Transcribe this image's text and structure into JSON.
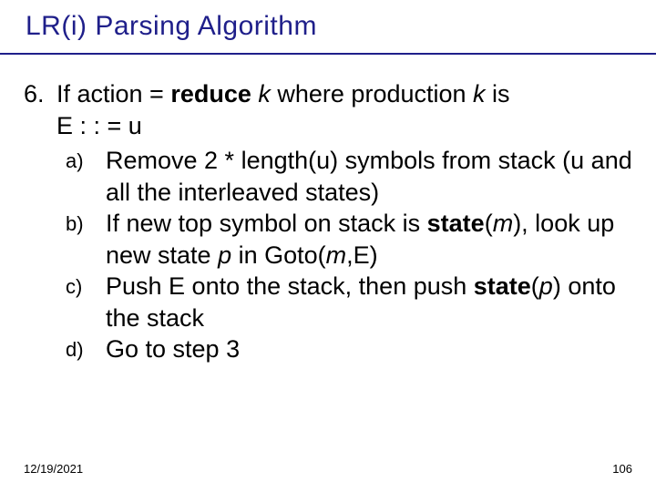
{
  "title": "LR(i) Parsing Algorithm",
  "item_number": "6.",
  "main_line_prefix": "If action = ",
  "main_line_reduce": "reduce",
  "main_line_mid1": " ",
  "main_line_k1": "k",
  "main_line_mid2": " where production ",
  "main_line_k2": "k",
  "main_line_suffix": " is",
  "main_line2": "E : : = u",
  "subs": [
    {
      "letter": "a)",
      "plain": "Remove 2 * length(u) symbols from stack (u and all the interleaved states)"
    },
    {
      "letter": "b)",
      "prefix": "If new top symbol on stack is ",
      "bold1": "state",
      "mid1": "(",
      "ital1": "m",
      "mid2": "), look up new state ",
      "ital2": "p",
      "mid3": " in Goto(",
      "ital3": "m",
      "mid4": ",E)"
    },
    {
      "letter": "c)",
      "prefix": "Push E onto the stack, then push ",
      "bold1": "state",
      "mid1": "(",
      "ital1": "p",
      "mid2": ") onto the stack"
    },
    {
      "letter": "d)",
      "plain": "Go to step 3"
    }
  ],
  "footer": {
    "date": "12/19/2021",
    "page": "106"
  }
}
